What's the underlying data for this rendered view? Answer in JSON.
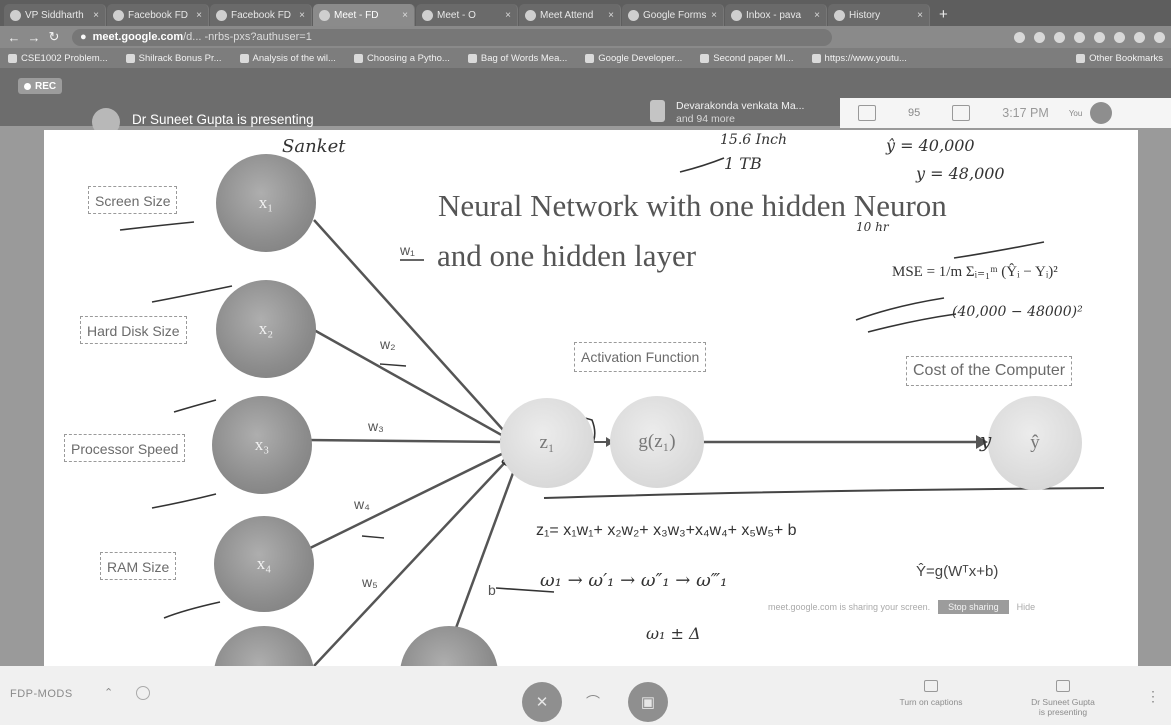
{
  "tabs": [
    {
      "label": "VP Siddharth",
      "active": false
    },
    {
      "label": "Facebook FD",
      "active": false
    },
    {
      "label": "Facebook FD",
      "active": false
    },
    {
      "label": "Meet - FD",
      "active": true
    },
    {
      "label": "Meet - O",
      "active": false
    },
    {
      "label": "Meet Attend",
      "active": false
    },
    {
      "label": "Google Forms",
      "active": false
    },
    {
      "label": "Inbox - pava",
      "active": false
    },
    {
      "label": "History",
      "active": false
    }
  ],
  "address": {
    "host": "meet.google.com",
    "path": "/d... -nrbs-pxs?authuser=1"
  },
  "bookmarks": [
    "CSE1002 Problem...",
    "Shilrack Bonus Pr...",
    "Analysis of the wil...",
    "Choosing a Pytho...",
    "Bag of Words Mea...",
    "Google Developer...",
    "Second paper MI...",
    "https://www.youtu..."
  ],
  "bookmarks_other": "Other Bookmarks",
  "meet": {
    "rec_label": "REC",
    "presenting_text": "Dr Suneet Gupta is presenting",
    "participant_name": "Devarakonda venkata Ma...",
    "participant_more": "and 94 more",
    "people_count": "95",
    "clock": "3:17 PM",
    "you_label": "You"
  },
  "slide": {
    "title": "Neural Network with one hidden Neuron",
    "subtitle": "and one hidden layer",
    "input_labels": [
      "Screen Size",
      "Hard Disk Size",
      "Processor Speed",
      "RAM Size"
    ],
    "input_nodes": [
      "x₁",
      "x₂",
      "x₃",
      "x₄"
    ],
    "weights": [
      "w₁",
      "w₂",
      "w₃",
      "w₄",
      "w₅"
    ],
    "bias_label": "b",
    "hidden_node": "z₁",
    "activation_node": "g(z₁)",
    "output_node": "ŷ",
    "activation_label": "Activation Function",
    "cost_label": "Cost of the Computer",
    "formula": "z₁= x₁w₁+ x₂w₂+ x₃w₃+x₄w₄+ x₅w₅+ b",
    "mse": "MSE = 1/m Σᵢ₌₁ᵐ (Ŷᵢ − Yᵢ)²",
    "yhat_formula": "Ŷ=g(Wᵀx+b)",
    "notification_text": "meet.google.com is sharing your screen.",
    "notification_button": "Stop sharing",
    "notification_hide": "Hide"
  },
  "handwriting": {
    "top_note": "Sanket",
    "price_line1": "15.6 Inch",
    "price_line2": "1 TB",
    "price_y1": "ŷ = 40,000",
    "price_y2": "y = 48,000",
    "hidden_note": "10 hr",
    "mse_note": "(40,000 − 48000)²",
    "weights_update": "ω₁ → ω′₁ → ω″₁ → ω‴₁",
    "delta_note": "ω₁ ± Δ",
    "output_note": "y"
  },
  "bottombar": {
    "meeting_code": "FDP-MODS",
    "captions_label": "Turn on captions",
    "presenter_label": "Dr Suneet Gupta",
    "presenter_sub": "is presenting"
  }
}
